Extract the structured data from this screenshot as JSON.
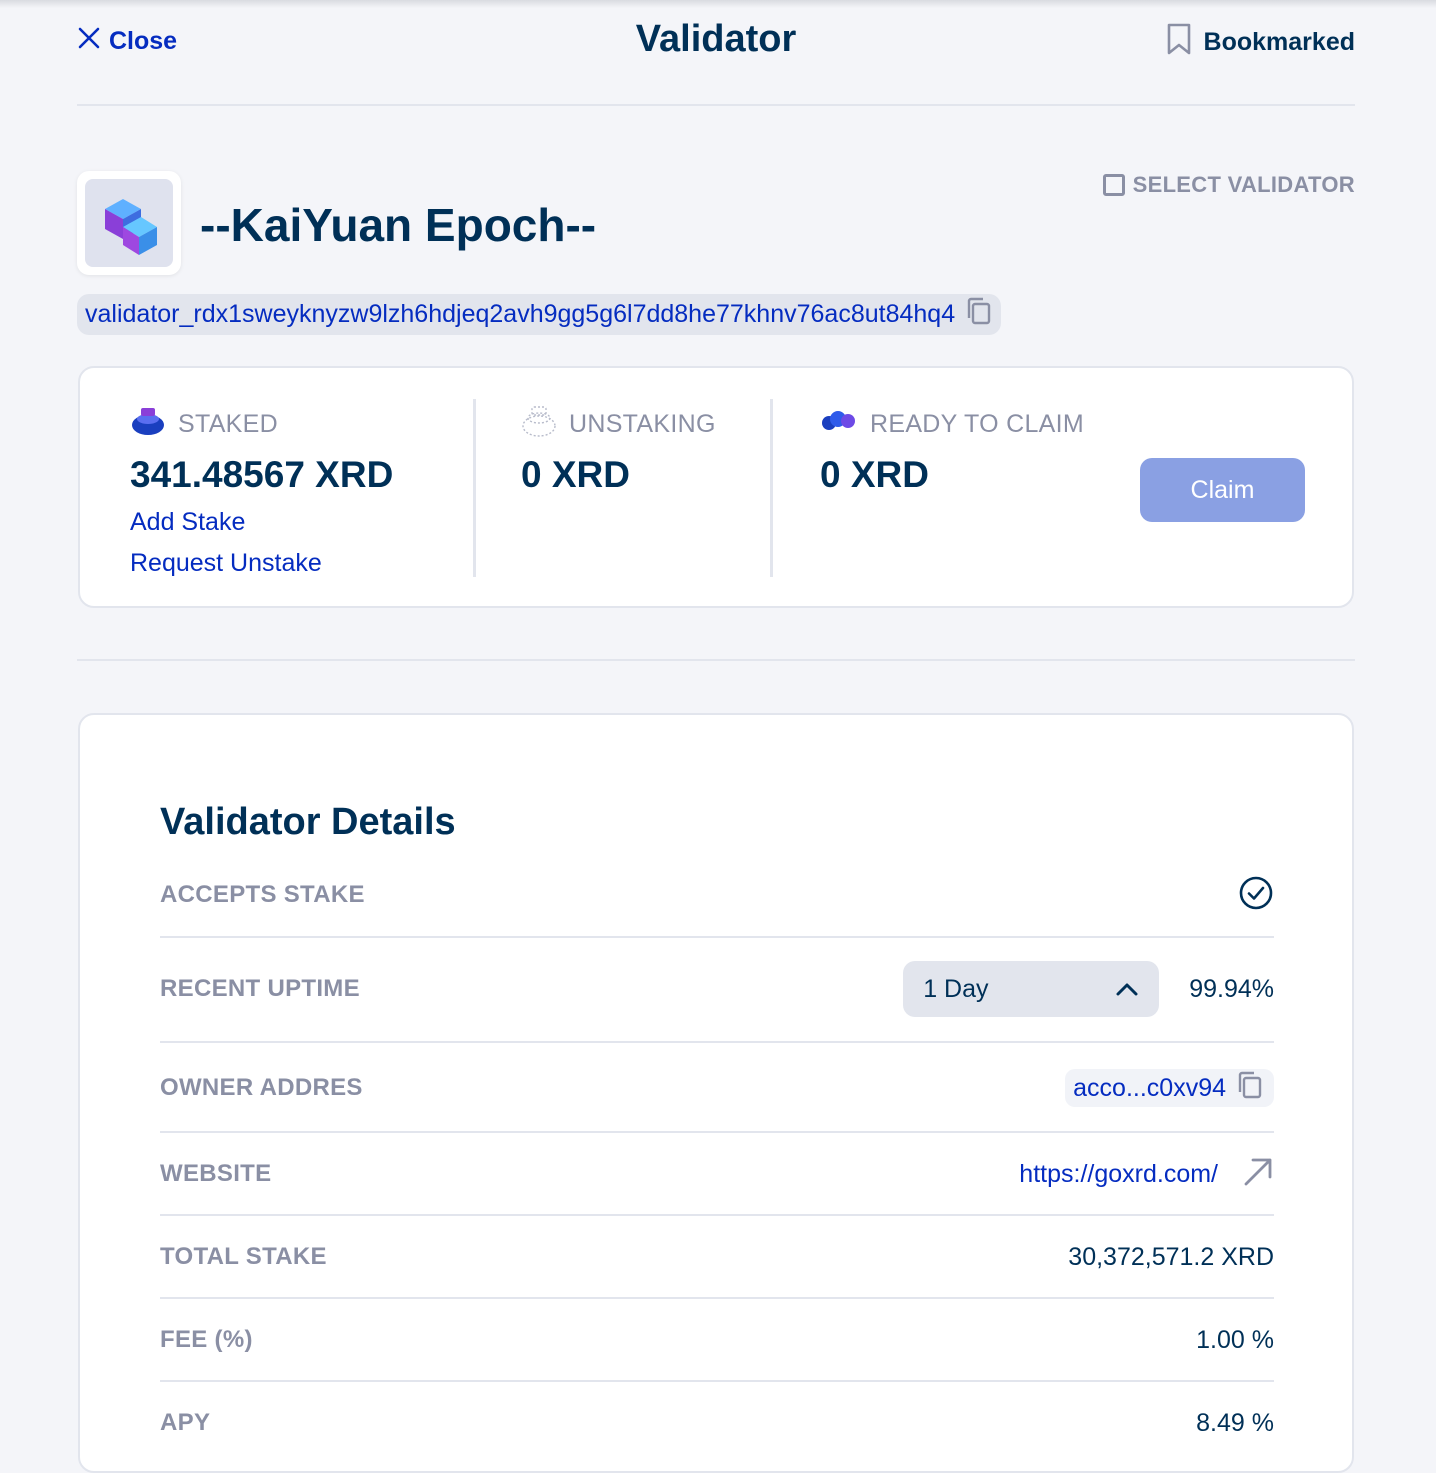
{
  "header": {
    "close_label": "Close",
    "title": "Validator",
    "bookmark_label": "Bookmarked"
  },
  "validator": {
    "name": "--KaiYuan Epoch--",
    "address": "validator_rdx1sweyknyzw9lzh6hdjeq2avh9gg5g6l7dd8he77khnv76ac8ut84hq4",
    "select_label": "SELECT VALIDATOR"
  },
  "stake": {
    "staked_label": "STAKED",
    "staked_value": "341.48567 XRD",
    "add_stake": "Add Stake",
    "request_unstake": "Request Unstake",
    "unstaking_label": "UNSTAKING",
    "unstaking_value": "0 XRD",
    "ready_label": "READY TO CLAIM",
    "ready_value": "0 XRD",
    "claim_label": "Claim"
  },
  "details": {
    "title": "Validator Details",
    "accepts_stake_label": "ACCEPTS STAKE",
    "recent_uptime_label": "RECENT UPTIME",
    "uptime_period": "1 Day",
    "uptime_value": "99.94%",
    "owner_label": "OWNER ADDRES",
    "owner_value": "acco...c0xv94",
    "website_label": "WEBSITE",
    "website_value": "https://goxrd.com/",
    "total_stake_label": "TOTAL STAKE",
    "total_stake_value": "30,372,571.2 XRD",
    "fee_label": "FEE (%)",
    "fee_value": "1.00 %",
    "apy_label": "APY",
    "apy_value": "8.49 %"
  },
  "colors": {
    "primary_text": "#003057",
    "link": "#052cc0",
    "muted": "#8a8fa4",
    "claim_button": "#8aa0e3",
    "background": "#f4f5f9"
  }
}
